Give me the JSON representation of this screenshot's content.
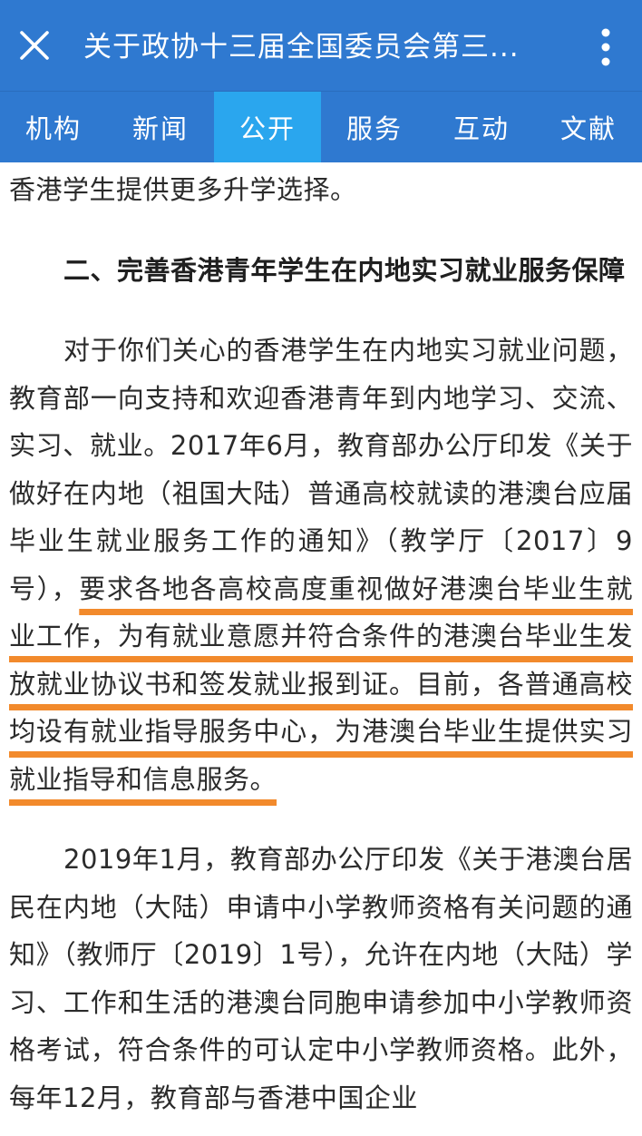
{
  "header": {
    "title": "关于政协十三届全国委员会第三...",
    "close_icon": "close-icon",
    "menu_icon": "more-vertical-icon",
    "background_color": "#2f79d0"
  },
  "tabs": [
    {
      "label": "机构",
      "active": false
    },
    {
      "label": "新闻",
      "active": false
    },
    {
      "label": "公开",
      "active": true
    },
    {
      "label": "服务",
      "active": false
    },
    {
      "label": "互动",
      "active": false
    },
    {
      "label": "文献",
      "active": false
    }
  ],
  "article": {
    "intro_fragment": "香港学生提供更多升学选择。",
    "section_heading": "二、完善香港青年学生在内地实习就业服务保障",
    "paragraph1": {
      "before": "对于你们关心的香港学生在内地实习就业问题，教育部一向支持和欢迎香港青年到内地学习、交流、实习、就业。2017年6月，教育部办公厅印发《关于做好在内地（祖国大陆）普通高校就读的港澳台应届毕业生就业服务工作的通知》（教学厅〔2017〕9号），",
      "highlighted": "要求各地各高校高度重视做好港澳台毕业生就业工作，为有就业意愿并符合条件的港澳台毕业生发放就业协议书和签发就业报到证。目前，各普通高校均设有就业指导服务中心，为港澳台毕业生提供实习就业指导和信息服务。"
    },
    "paragraph2": "2019年1月，教育部办公厅印发《关于港澳台居民在内地（大陆）申请中小学教师资格有关问题的通知》（教师厅〔2019〕1号），允许在内地（大陆）学习、工作和生活的港澳台同胞申请参加中小学教师资格考试，符合条件的可认定中小学教师资格。此外，每年12月，教育部与香港中国企业",
    "highlight_color": "#f28a2c"
  }
}
